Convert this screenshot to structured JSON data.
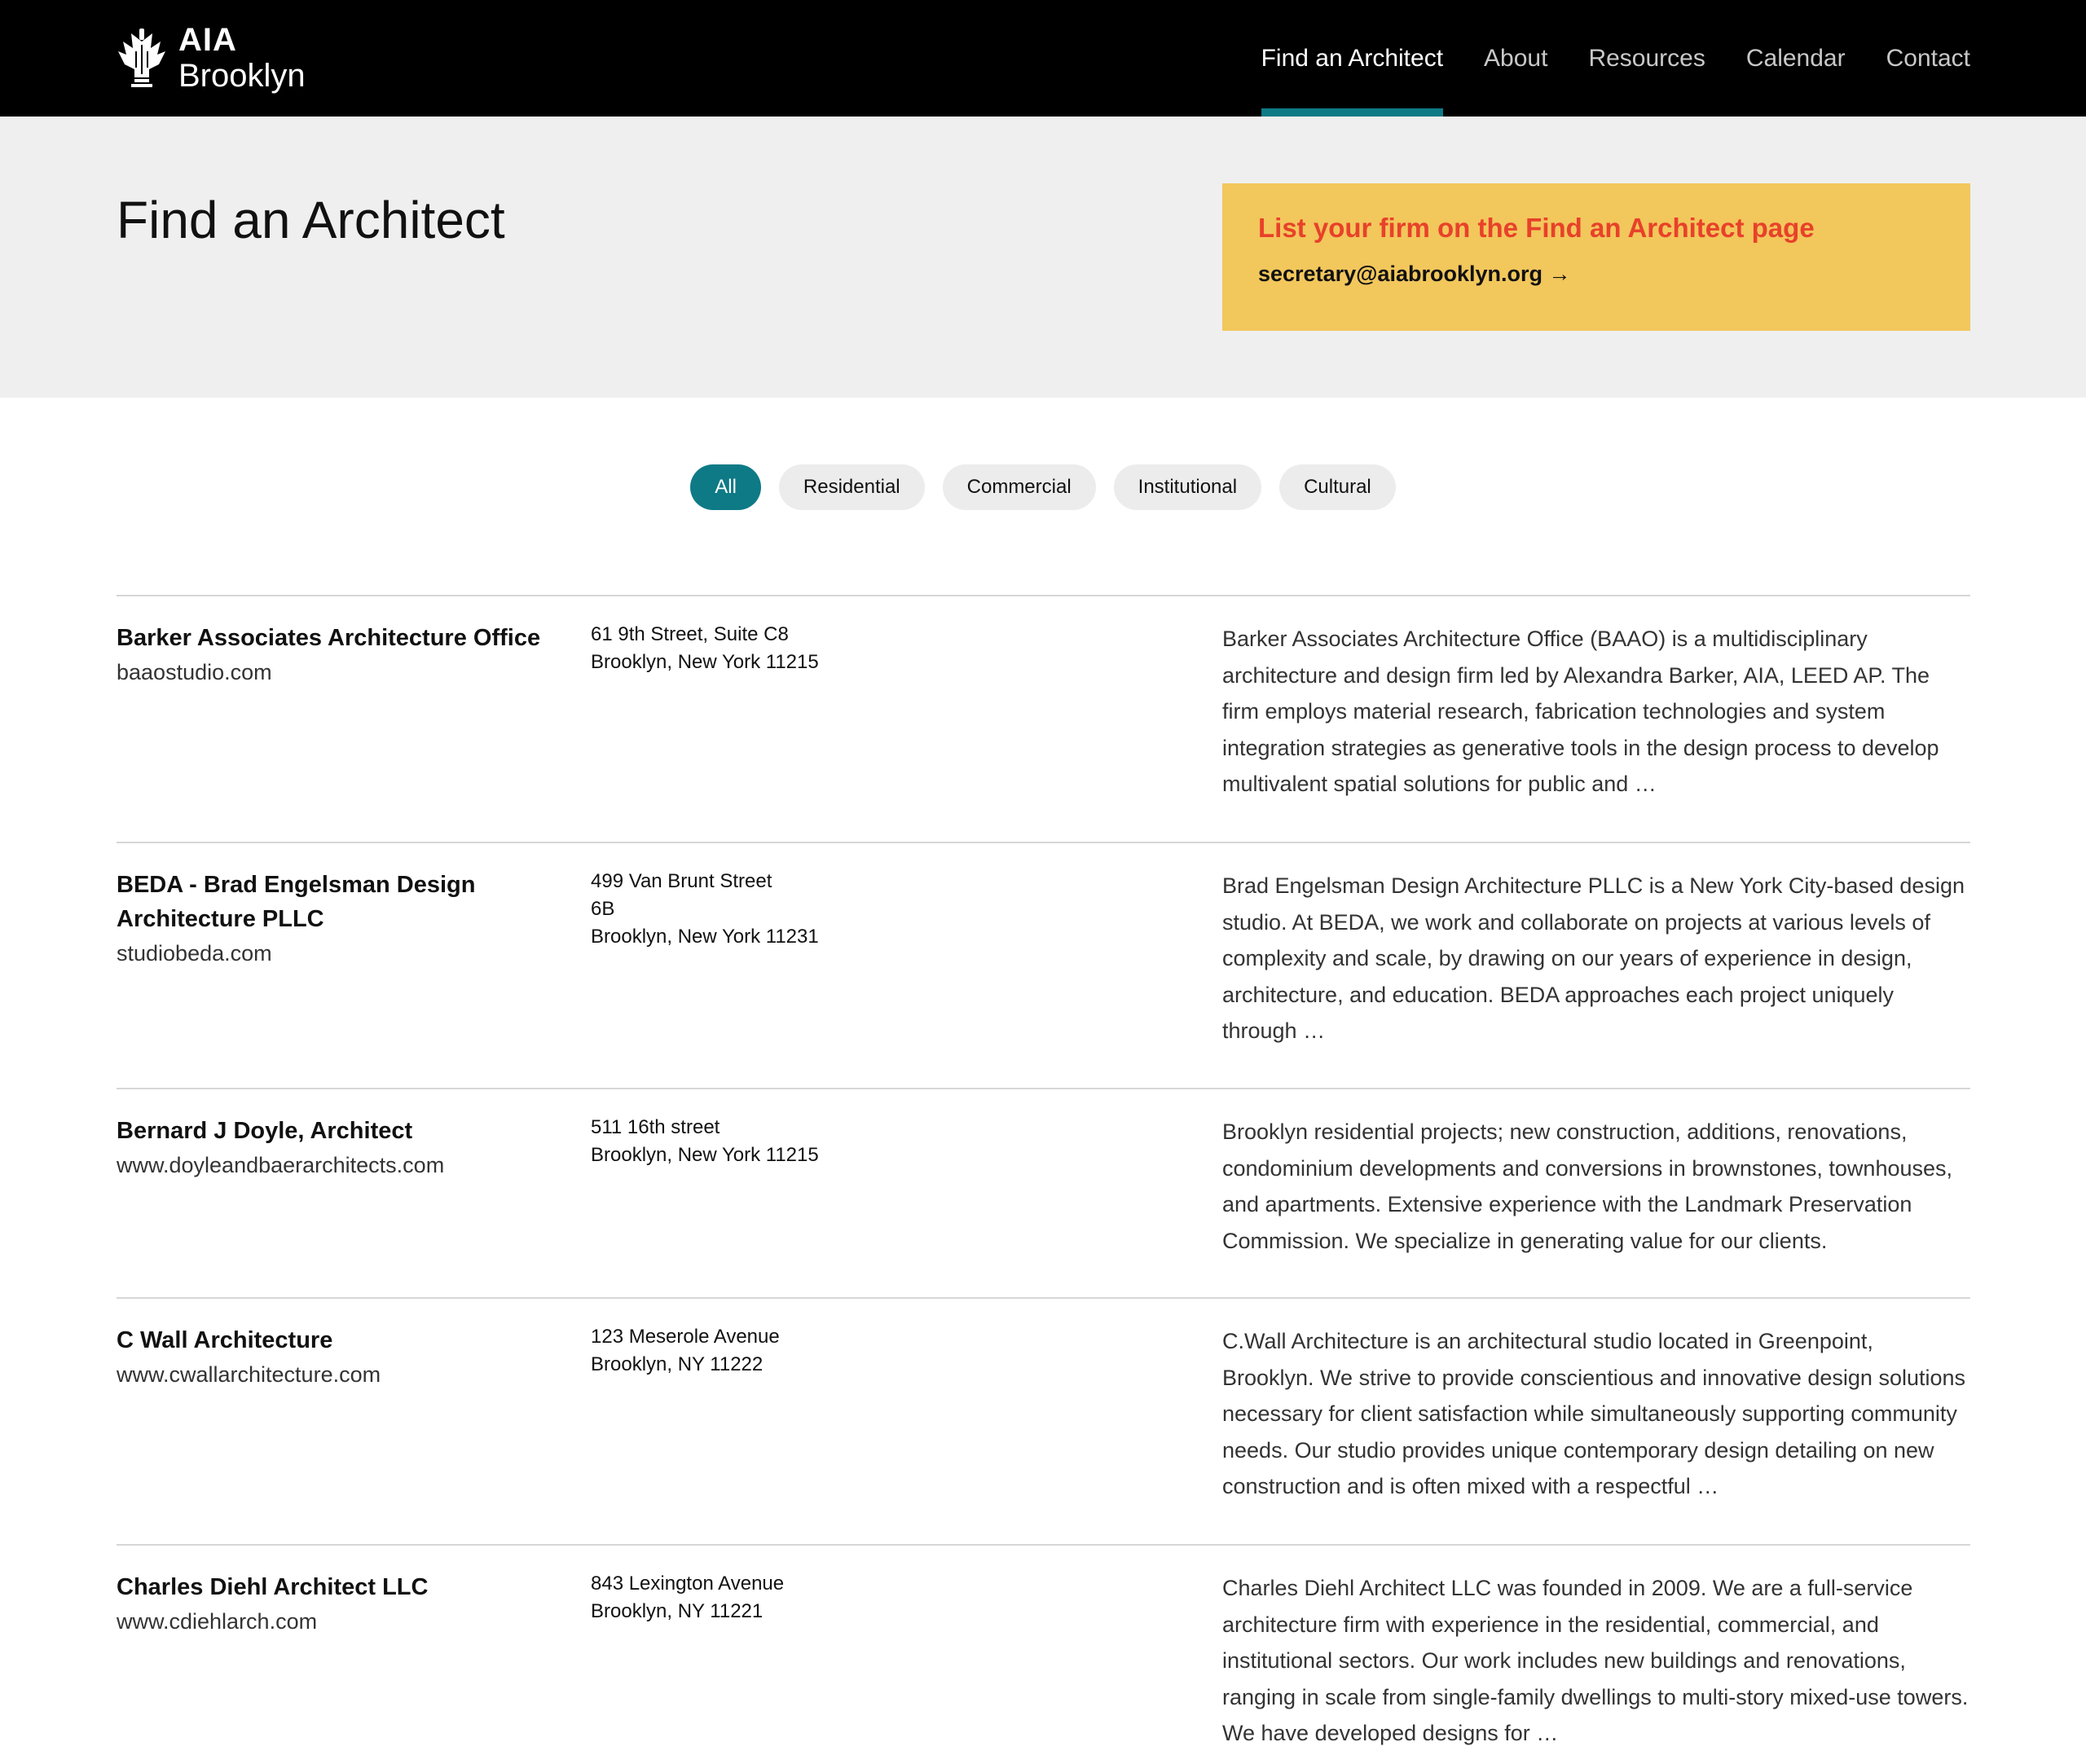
{
  "header": {
    "logo_line1": "AIA",
    "logo_line2": "Brooklyn",
    "nav": [
      "Find an Architect",
      "About",
      "Resources",
      "Calendar",
      "Contact"
    ],
    "active_nav": "Find an Architect"
  },
  "hero": {
    "title": "Find an Architect",
    "cta_heading": "List your firm on the Find an Architect page",
    "cta_email": "secretary@aiabrooklyn.org →"
  },
  "filters": {
    "items": [
      "All",
      "Residential",
      "Commercial",
      "Institutional",
      "Cultural"
    ],
    "active": "All"
  },
  "firms": [
    {
      "name": "Barker Associates Architecture Office",
      "url": "baaostudio.com",
      "address": [
        "61 9th Street, Suite C8",
        "Brooklyn, New York 11215"
      ],
      "description": "Barker Associates Architecture Office (BAAO) is a multidisciplinary architecture and design firm led by Alexandra Barker, AIA, LEED AP. The firm employs material research, fabrication technologies and system integration strategies as generative tools in the design process to develop multivalent spatial solutions for public and …"
    },
    {
      "name": "BEDA - Brad Engelsman Design Architecture PLLC",
      "url": "studiobeda.com",
      "address": [
        "499 Van Brunt Street",
        "6B",
        "Brooklyn, New York 11231"
      ],
      "description": "Brad Engelsman Design Architecture PLLC is a New York City-based design studio. At BEDA, we work and collaborate on projects at various levels of complexity and scale, by drawing on our years of experience in design, architecture, and education. BEDA approaches each project uniquely through …"
    },
    {
      "name": "Bernard J Doyle, Architect",
      "url": "www.doyleandbaerarchitects.com",
      "address": [
        "511 16th street",
        "Brooklyn, New York 11215"
      ],
      "description": "Brooklyn residential projects; new construction, additions, renovations, condominium developments and conversions in brownstones, townhouses, and apartments. Extensive experience with the Landmark Preservation Commission. We specialize in generating value for our clients."
    },
    {
      "name": "C Wall Architecture",
      "url": "www.cwallarchitecture.com",
      "address": [
        "123 Meserole Avenue",
        "Brooklyn, NY 11222"
      ],
      "description": "C.Wall Architecture is an architectural studio located in Greenpoint, Brooklyn. We strive to provide conscientious and innovative design solutions necessary for client satisfaction while simultaneously supporting community needs. Our studio provides unique contemporary design detailing on new construction and is often mixed with a respectful …"
    },
    {
      "name": "Charles Diehl Architect LLC",
      "url": "www.cdiehlarch.com",
      "address": [
        "843 Lexington Avenue",
        "Brooklyn, NY 11221"
      ],
      "description": "Charles Diehl Architect LLC was founded in 2009. We are a full-service architecture firm with experience in the residential, commercial, and institutional sectors. Our work includes new buildings and renovations, ranging in scale from single-family dwellings to multi-story mixed-use towers. We have developed designs for …"
    }
  ],
  "colors": {
    "header_bg": "#000000",
    "accent_teal": "#0e7a86",
    "cta_bg": "#f2c75c",
    "cta_heading": "#e8412a",
    "hero_bg": "#efefef"
  }
}
